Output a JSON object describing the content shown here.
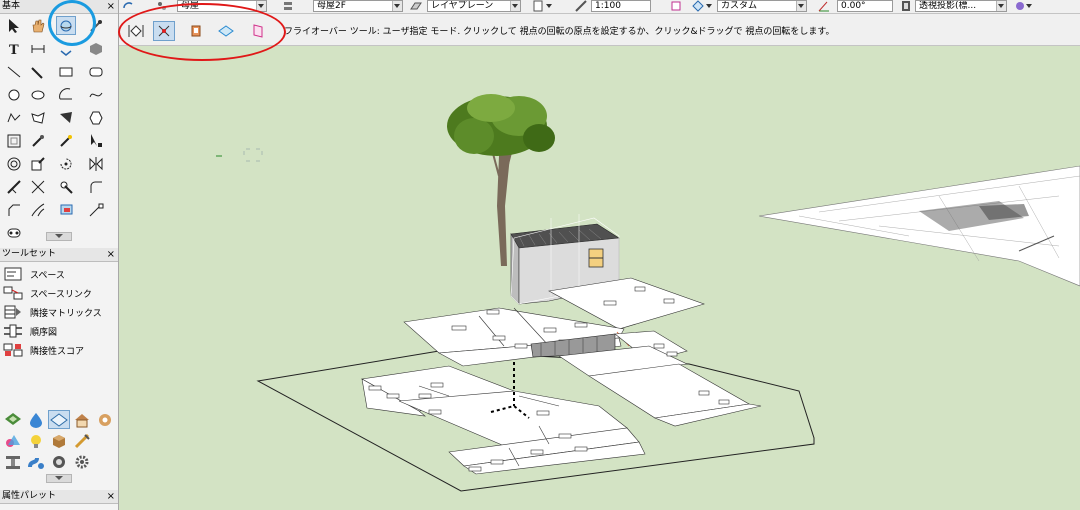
{
  "left_palette": {
    "basic_title": "基本",
    "toolset_title": "ツールセット",
    "attr_title": "属性パレット",
    "close_glyph": "×",
    "toolset_items": [
      {
        "label": "スペース"
      },
      {
        "label": "スペースリンク"
      },
      {
        "label": "隣接マトリックス"
      },
      {
        "label": "順序図"
      },
      {
        "label": "隣接性スコア"
      }
    ]
  },
  "top_bar": {
    "class_value": "母屋",
    "layer_value": "母屋2F",
    "plane_value": "レイヤプレーン",
    "scale_value": "1:100",
    "view_value": "カスタム",
    "angle_value": "0.00°",
    "projection_value": "透視投影(標..."
  },
  "mode_bar": {
    "hint_text": "フライオーバー ツール: ユーザ指定 モード. クリックして 視点の回転の原点を設定するか、クリック&ドラッグで 視点の回転をします。"
  },
  "colors": {
    "viewport_bg": "#d3e3c4",
    "selection": "#c9ddf0",
    "annotation_red": "#e01818",
    "annotation_blue": "#1a9be0"
  },
  "icons": {
    "basic_tools": [
      "selection-icon",
      "pan-hand-icon",
      "flyover-icon",
      "eyedropper-icon",
      "text-icon",
      "dimension-icon",
      "flyover-sub-icon",
      "material-icon",
      "line-icon",
      "double-line-icon",
      "rectangle-icon",
      "rounded-rectangle-icon",
      "circle-icon",
      "oval-icon",
      "arc-icon",
      "freehand-icon",
      "polyline-icon",
      "polygon-icon",
      "sector-icon",
      "hexagon-icon",
      "offset-icon",
      "eyedropper2-icon",
      "magic-wand-icon",
      "reshape-icon",
      "concentric-icon",
      "attribute-mapping-icon",
      "rotate-icon",
      "mirror-icon",
      "split-icon",
      "trim-icon",
      "connect-icon",
      "fillet-icon",
      "chamfer-icon",
      "fill-icon",
      "clip-icon",
      "3d-locus-icon"
    ]
  }
}
